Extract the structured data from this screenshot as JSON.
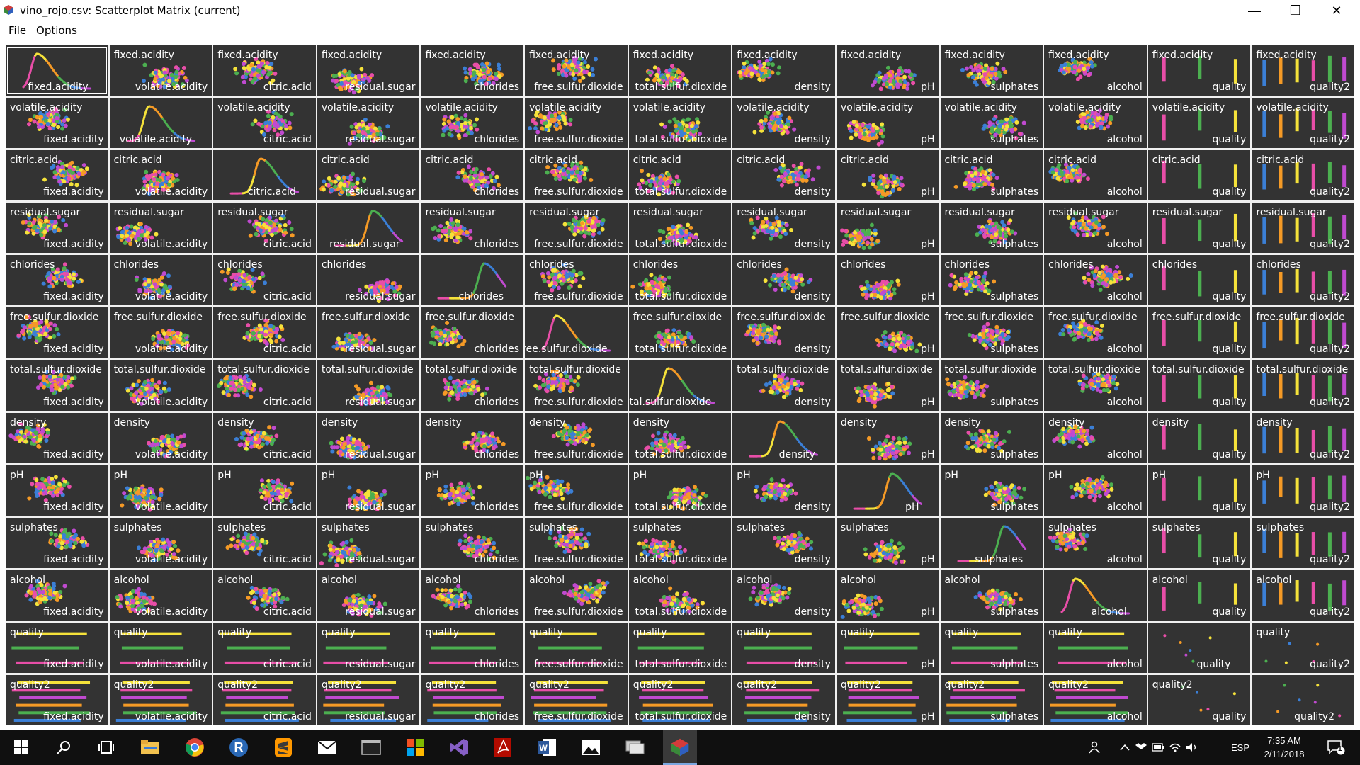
{
  "window": {
    "title": "vino_rojo.csv: Scatterplot Matrix (current)",
    "minimize_glyph": "—",
    "restore_glyph": "❐",
    "close_glyph": "✕"
  },
  "menu": {
    "items": [
      "File",
      "Options"
    ]
  },
  "matrix": {
    "variables": [
      "fixed.acidity",
      "volatile.acidity",
      "citric.acid",
      "residual.sugar",
      "chlorides",
      "free.sulfur.dioxide",
      "total.sulfur.dioxide",
      "density",
      "pH",
      "sulphates",
      "alcohol",
      "quality",
      "quality2"
    ],
    "palette": [
      "#e84ea8",
      "#f5e23a",
      "#f59a26",
      "#4caf50",
      "#3b7fd6",
      "#c04ad0"
    ],
    "background_color": "#333333"
  },
  "taskbar": {
    "apps": [
      "start-icon",
      "search-icon",
      "task-view-icon",
      "file-explorer-icon",
      "chrome-icon",
      "r-icon",
      "sublime-icon",
      "mail-icon",
      "terminal-icon",
      "apps-icon",
      "visual-studio-icon",
      "acrobat-icon",
      "word-icon",
      "photos-icon",
      "network-icon",
      "ggobi-icon"
    ],
    "language": "ESP",
    "time": "7:35 AM",
    "date": "2/11/2018",
    "notification_count": "1"
  }
}
